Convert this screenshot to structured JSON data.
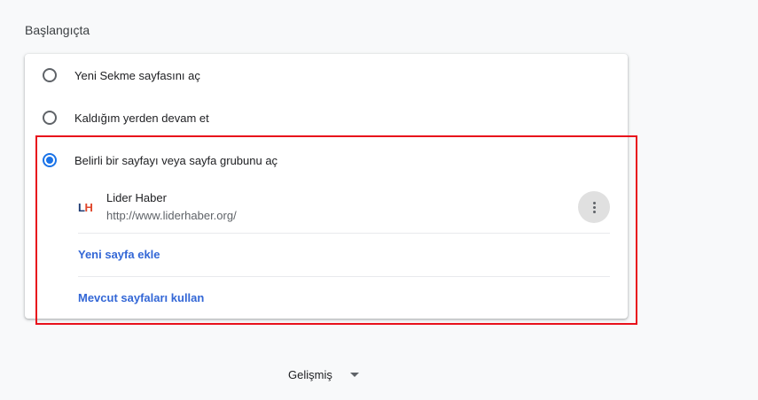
{
  "section": {
    "title": "Başlangıçta"
  },
  "options": [
    {
      "label": "Yeni Sekme sayfasını aç",
      "checked": false
    },
    {
      "label": "Kaldığım yerden devam et",
      "checked": false
    },
    {
      "label": "Belirli bir sayfayı veya sayfa grubunu aç",
      "checked": true
    }
  ],
  "page_entry": {
    "favicon_text_l": "L",
    "favicon_text_h": "H",
    "name": "Lider Haber",
    "url": "http://www.liderhaber.org/",
    "menu_icon": "more-vert-icon"
  },
  "actions": {
    "add_page": "Yeni sayfa ekle",
    "use_current": "Mevcut sayfaları kullan"
  },
  "advanced": {
    "label": "Gelişmiş"
  },
  "colors": {
    "accent": "#1a73e8",
    "link": "#3367d6",
    "highlight": "#e8101b"
  }
}
